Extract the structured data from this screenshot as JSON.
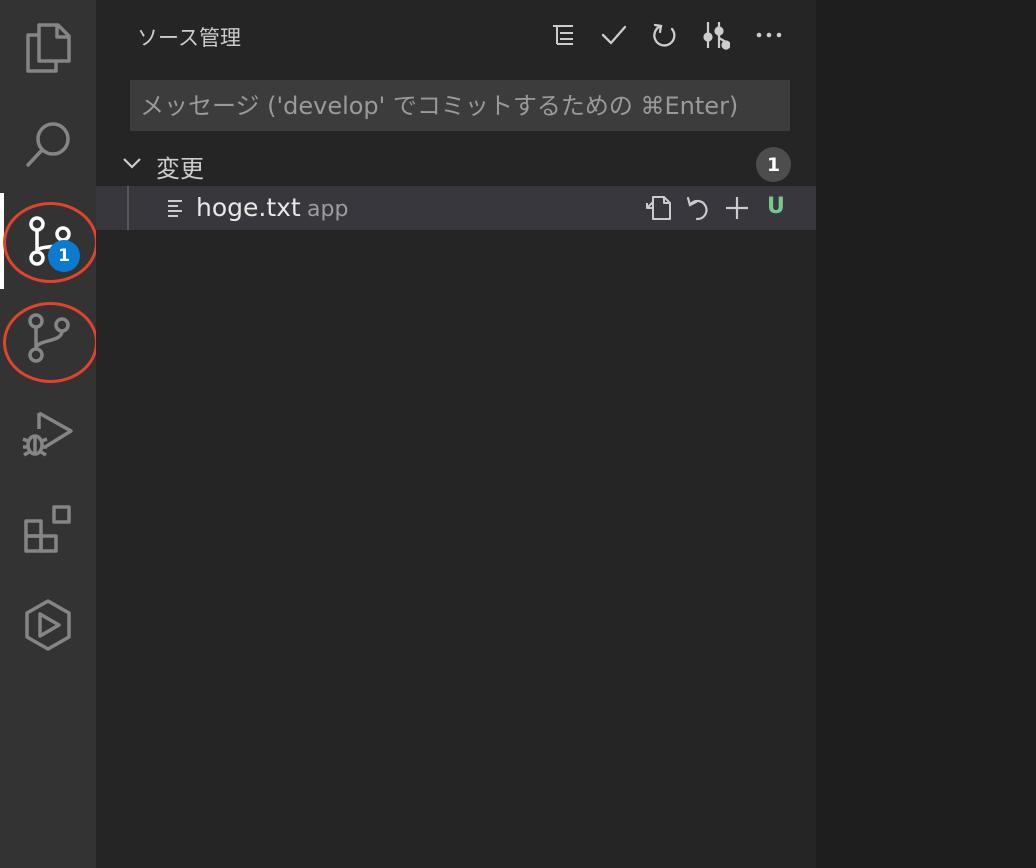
{
  "activity_bar": {
    "items": [
      {
        "name": "files-icon"
      },
      {
        "name": "search-icon"
      },
      {
        "name": "source-control-icon",
        "badge": "1"
      },
      {
        "name": "branch-icon"
      },
      {
        "name": "run-debug-icon"
      },
      {
        "name": "extensions-icon"
      },
      {
        "name": "remote-explorer-icon"
      }
    ],
    "highlight_color": "#e0432e"
  },
  "sidebar": {
    "title": "ソース管理",
    "toolbar": [
      "tree-view-icon",
      "commit-check-icon",
      "refresh-icon",
      "graph-icon",
      "more-icon"
    ],
    "commit_message": {
      "value": "",
      "placeholder": "メッセージ ('develop' でコミットするための ⌘Enter)"
    },
    "changes_group": {
      "label": "変更",
      "count": "1",
      "files": [
        {
          "name": "hoge.txt",
          "description": "app",
          "status": "U",
          "actions": [
            "open-file-icon",
            "discard-icon",
            "stage-icon"
          ]
        }
      ]
    }
  },
  "colors": {
    "accent": "#0b7ad1",
    "untracked": "#73c991",
    "activity_bg": "#333333",
    "sidebar_bg": "#252526"
  }
}
